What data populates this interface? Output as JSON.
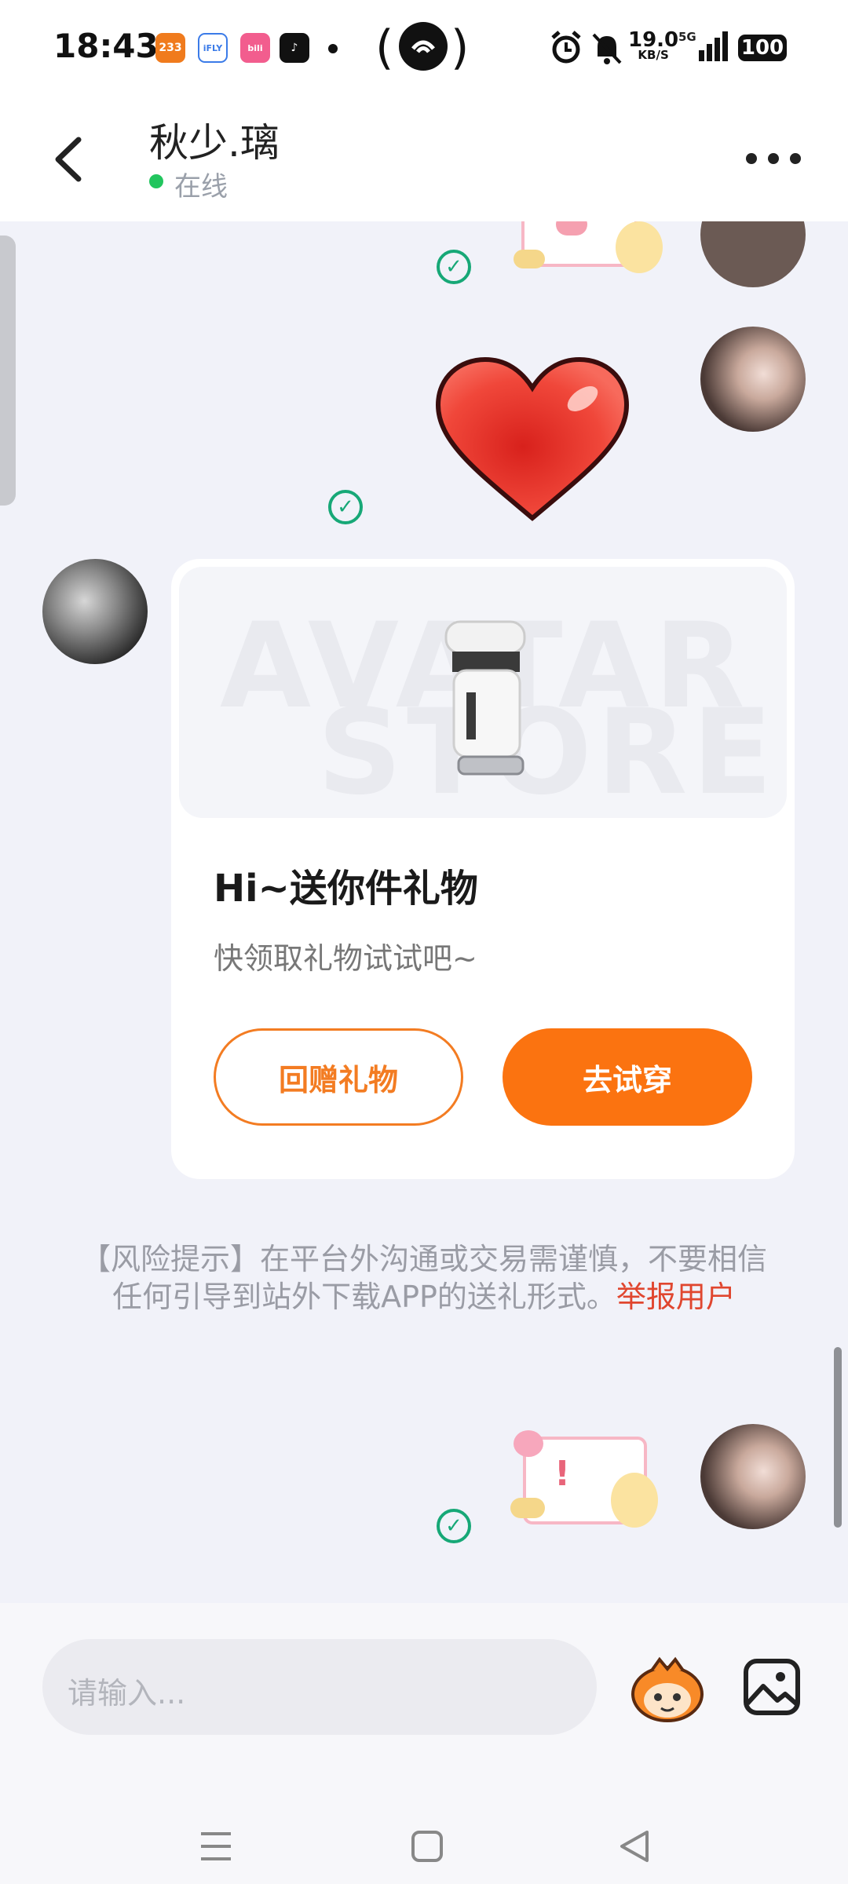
{
  "status_bar": {
    "time": "18:43",
    "app_icons": [
      {
        "name": "233",
        "color": "#f07b1d"
      },
      {
        "name": "iFLY",
        "color": "#ffffff"
      },
      {
        "name": "bilibili",
        "color": "#f25d8e"
      },
      {
        "name": "tiktok",
        "color": "#111111"
      }
    ],
    "net_speed_value": "19.0",
    "net_speed_unit": "KB/S",
    "network": "5G",
    "battery": "100"
  },
  "header": {
    "contact_name": "秋少.璃",
    "status": "在线"
  },
  "gift_card": {
    "watermark_line1": "AVATAR",
    "watermark_line2": "STORE",
    "title": "Hi~送你件礼物",
    "subtitle": "快领取礼物试试吧~",
    "return_gift_label": "回赠礼物",
    "try_on_label": "去试穿"
  },
  "risk_notice": {
    "text": "【风险提示】在平台外沟通或交易需谨慎，不要相信任何引导到站外下载APP的送礼形式。",
    "link": "举报用户"
  },
  "input": {
    "placeholder": "请输入..."
  },
  "colors": {
    "accent": "#fb7310",
    "read_check": "#17a877",
    "online": "#22c55e",
    "report_link": "#e0462f"
  }
}
